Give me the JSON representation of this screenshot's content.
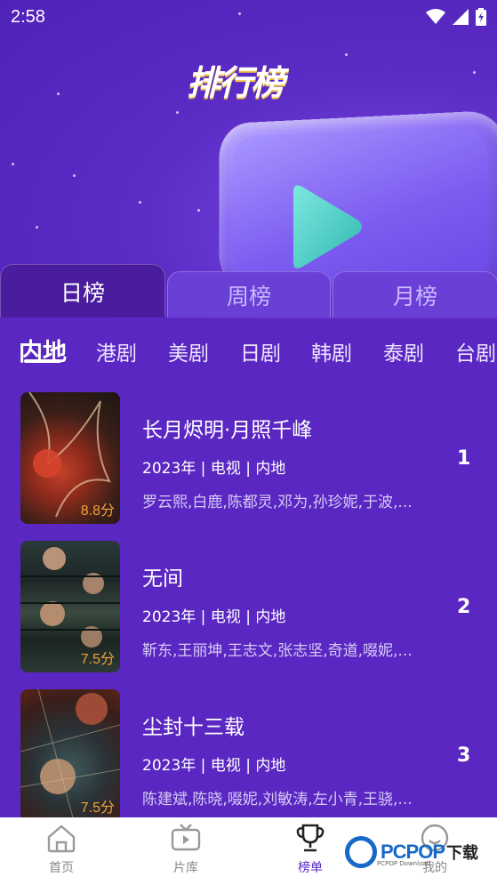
{
  "status_bar": {
    "time": "2:58"
  },
  "header": {
    "title": "排行榜"
  },
  "period_tabs": [
    {
      "label": "日榜",
      "active": true
    },
    {
      "label": "周榜",
      "active": false
    },
    {
      "label": "月榜",
      "active": false
    }
  ],
  "categories": [
    {
      "label": "内地",
      "active": true
    },
    {
      "label": "港剧"
    },
    {
      "label": "美剧"
    },
    {
      "label": "日剧"
    },
    {
      "label": "韩剧"
    },
    {
      "label": "泰剧"
    },
    {
      "label": "台剧"
    }
  ],
  "items": [
    {
      "title": "长月烬明·月照千峰",
      "meta": "2023年 | 电视 | 内地",
      "cast": "罗云熙,白鹿,陈都灵,邓为,孙珍妮,于波,...",
      "score": "8.8分",
      "rank": "1"
    },
    {
      "title": "无间",
      "meta": "2023年 | 电视 | 内地",
      "cast": "靳东,王丽坤,王志文,张志坚,奇道,啜妮,...",
      "score": "7.5分",
      "rank": "2"
    },
    {
      "title": "尘封十三载",
      "meta": "2023年 | 电视 | 内地",
      "cast": "陈建斌,陈晓,啜妮,刘敏涛,左小青,王骁,...",
      "score": "7.5分",
      "rank": "3"
    }
  ],
  "bottom_nav": [
    {
      "label": "首页",
      "icon": "home-icon",
      "active": false
    },
    {
      "label": "片库",
      "icon": "tv-icon",
      "active": false
    },
    {
      "label": "榜单",
      "icon": "trophy-icon",
      "active": true
    },
    {
      "label": "我的",
      "icon": "profile-icon",
      "active": false
    }
  ],
  "watermark": {
    "brand": "PCPOP",
    "suffix": "下载",
    "sub": "PCPOP Download"
  },
  "colors": {
    "primary": "#5a27c2",
    "score": "#f0a23a",
    "nav_active": "#5a27c2"
  }
}
